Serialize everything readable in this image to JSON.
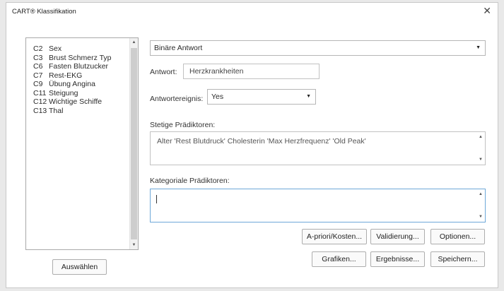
{
  "window": {
    "title": "CART® Klassifikation",
    "close_glyph": "✕"
  },
  "variable_list": {
    "items": [
      {
        "code": "C2",
        "label": "Sex"
      },
      {
        "code": "C3",
        "label": "Brust Schmerz Typ"
      },
      {
        "code": "C6",
        "label": "Fasten Blutzucker"
      },
      {
        "code": "C7",
        "label": "Rest-EKG"
      },
      {
        "code": "C9",
        "label": "Übung Angina"
      },
      {
        "code": "C11",
        "label": "Steigung"
      },
      {
        "code": "C12",
        "label": "Wichtige Schiffe"
      },
      {
        "code": "C13",
        "label": "Thal"
      }
    ],
    "select_label": "Auswählen"
  },
  "response_type": {
    "selected": "Binäre Antwort"
  },
  "response": {
    "label": "Antwort:",
    "value": "Herzkrankheiten"
  },
  "response_event": {
    "label": "Antwortereignis:",
    "selected": "Yes"
  },
  "continuous": {
    "label": "Stetige Prädiktoren:",
    "value": "Alter 'Rest Blutdruck' Cholesterin 'Max Herzfrequenz' 'Old Peak'"
  },
  "categorical": {
    "label": "Kategoriale Prädiktoren:",
    "value": ""
  },
  "buttons": {
    "prior_costs": "A-priori/Kosten...",
    "validation": "Validierung...",
    "options": "Optionen...",
    "graphs": "Grafiken...",
    "results": "Ergebnisse...",
    "save": "Speichern..."
  },
  "colors": {
    "focus_border": "#6ea8d8",
    "dialog_bg": "#ffffff",
    "outer_bg": "#e9e9e9"
  }
}
